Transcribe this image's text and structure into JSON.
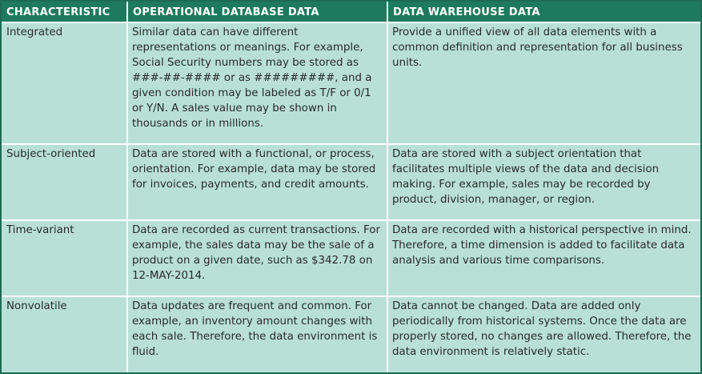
{
  "header": {
    "characteristic": "CHARACTERISTIC",
    "operational": "OPERATIONAL DATABASE DATA",
    "warehouse": "DATA WAREHOUSE DATA"
  },
  "rows": [
    {
      "characteristic": "Integrated",
      "operational": "Similar data can have different representations or meanings. For example, Social Security numbers may be stored as ###-##-#### or as #########, and a given condition may be labeled as T/F or 0/1 or Y/N. A sales value may be shown in thousands or in millions.",
      "warehouse": "Provide a unified view of all data elements with a common definition and representation for all business units."
    },
    {
      "characteristic": "Subject-oriented",
      "operational": "Data are stored with a functional, or process, orientation. For example, data may be stored for invoices, payments, and credit amounts.",
      "warehouse": "Data are stored with a subject orientation that facilitates multiple views of the data and decision making. For example, sales may be recorded by product, division, manager, or region."
    },
    {
      "characteristic": "Time-variant",
      "operational": "Data are recorded as current transactions. For example, the sales data may be the sale of a product on a given date, such as $342.78 on 12-MAY-2014.",
      "warehouse": "Data are recorded with a historical perspective in mind. Therefore, a time dimension is added to facilitate data analysis and various time comparisons."
    },
    {
      "characteristic": "Nonvolatile",
      "operational": "Data updates are frequent and common. For example, an inventory amount changes with each sale. Therefore, the data environment is fluid.",
      "warehouse": "Data cannot be changed. Data are added only periodically from historical systems. Once the data are properly stored, no changes are allowed. Therefore, the data environment is relatively static."
    }
  ],
  "colors": {
    "header_bg": "#1e7a5c",
    "cell_bg": "#b9e0d6",
    "border": "#1d6b52",
    "divider": "#ffffff"
  }
}
